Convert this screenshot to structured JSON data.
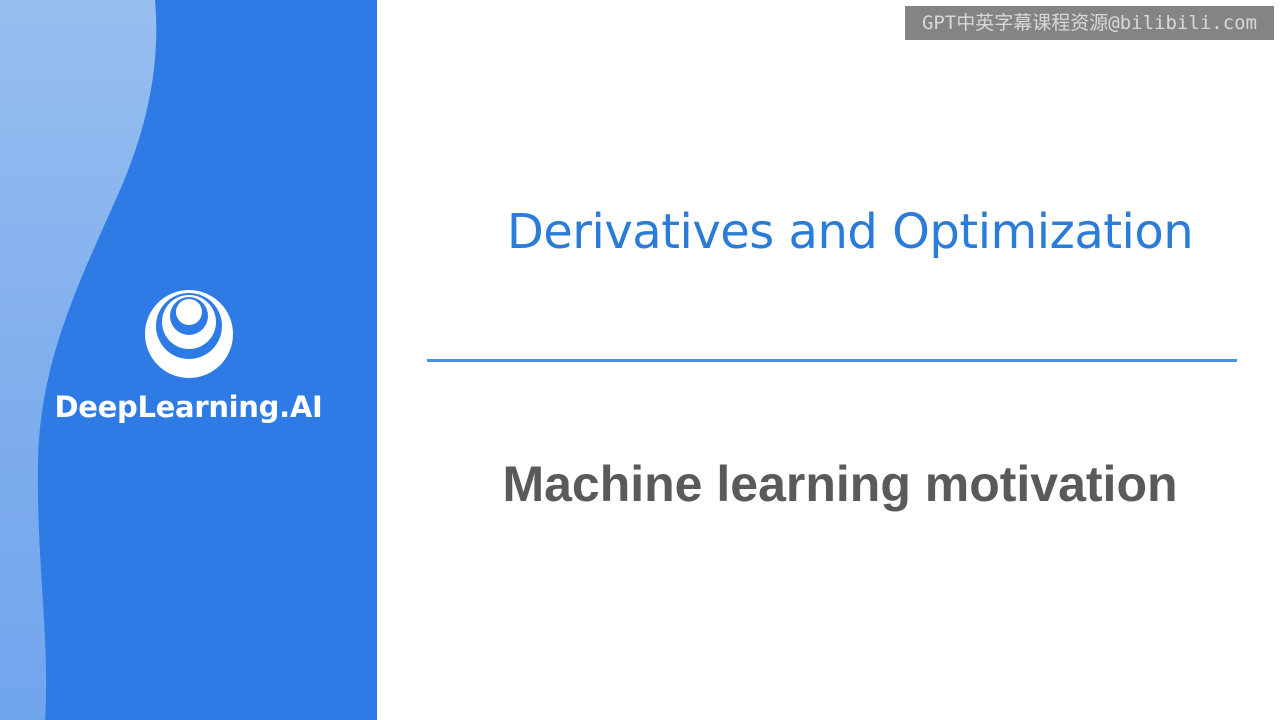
{
  "brand": {
    "name": "DeepLearning.AI",
    "logo_icon": "deeplearning-ai-logo-icon"
  },
  "slide": {
    "title": "Derivatives and Optimization",
    "subtitle": "Machine learning motivation"
  },
  "watermark": {
    "text": "GPT中英字幕课程资源@bilibili.com"
  },
  "colors": {
    "sidebar": "#2f7be6",
    "sidebar_light": "#8fb8ee",
    "title": "#2b7bd9",
    "divider": "#4a8fe3",
    "subtitle": "#5a5a5a"
  }
}
